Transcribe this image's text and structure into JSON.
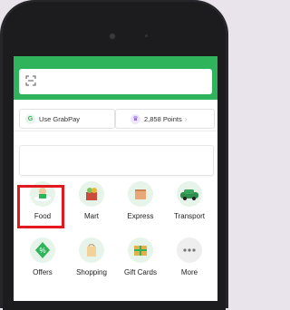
{
  "screen": {
    "grabpay_label": "Use GrabPay",
    "points_label": "2,858 Points"
  },
  "services": [
    {
      "label": "Food",
      "icon": "food-icon"
    },
    {
      "label": "Mart",
      "icon": "mart-icon"
    },
    {
      "label": "Express",
      "icon": "express-icon"
    },
    {
      "label": "Transport",
      "icon": "transport-icon"
    },
    {
      "label": "Offers",
      "icon": "offers-icon"
    },
    {
      "label": "Shopping",
      "icon": "shopping-icon"
    },
    {
      "label": "Gift Cards",
      "icon": "gift-cards-icon"
    },
    {
      "label": "More",
      "icon": "more-icon"
    }
  ],
  "colors": {
    "header_green": "#2fb35b",
    "highlight_red": "#e3191f"
  }
}
